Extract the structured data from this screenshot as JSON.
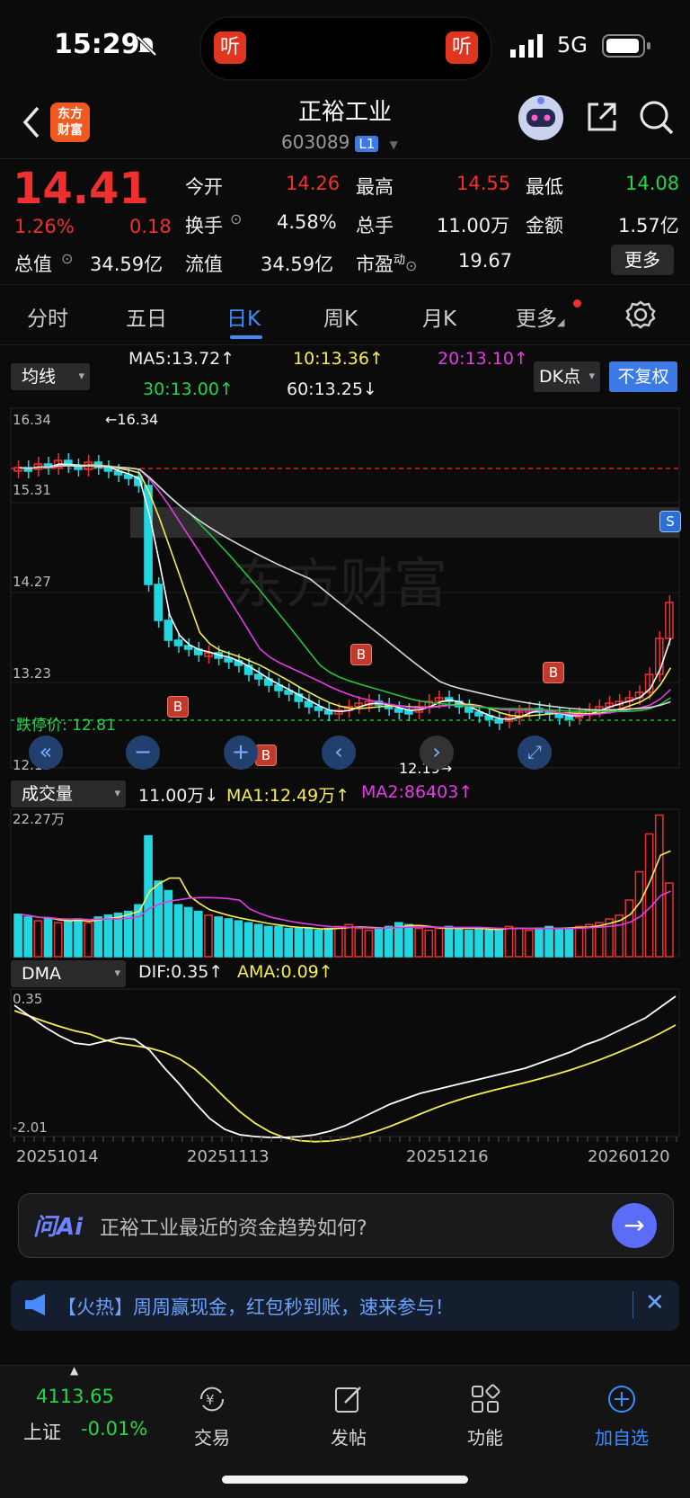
{
  "status": {
    "time": "15:29",
    "network": "5G",
    "island_left": "听",
    "island_right": "听"
  },
  "header": {
    "logo": "东方\n财富",
    "stock_name": "正裕工业",
    "stock_code": "603089",
    "level": "L1"
  },
  "quote": {
    "price": "14.41",
    "pct": "1.26%",
    "change": "0.18",
    "open_label": "今开",
    "open": "14.26",
    "high_label": "最高",
    "high": "14.55",
    "low_label": "最低",
    "low": "14.08",
    "turnover_label": "换手",
    "turnover": "4.58%",
    "volume_label": "总手",
    "volume": "11.00万",
    "amount_label": "金额",
    "amount": "1.57亿",
    "mktcap_label": "总值",
    "mktcap": "34.59亿",
    "float_label": "流值",
    "float": "34.59亿",
    "pe_label": "市盈",
    "pe_sup": "动",
    "pe": "19.67",
    "more": "更多"
  },
  "tabs": [
    "分时",
    "五日",
    "日K",
    "周K",
    "月K",
    "更多"
  ],
  "kline": {
    "indicator_select": "均线",
    "ma5": "MA5:13.72↑",
    "ma10": "10:13.36↑",
    "ma20": "20:13.10↑",
    "ma30": "30:13.00↑",
    "ma60": "60:13.25↓",
    "dk_button": "DK点",
    "fq_button": "不复权",
    "y_top": "16.34",
    "y_mid1": "15.31",
    "y_mid2": "14.27",
    "y_mid3": "13.23",
    "y_bottom": "12.19",
    "max_mark": "←16.34",
    "min_mark": "12.19→",
    "limit_down": "跌停价: 12.81",
    "b_marker": "B",
    "s_marker": "S"
  },
  "volume_panel": {
    "select": "成交量",
    "vol": "11.00万↓",
    "ma1": "MA1:12.49万↑",
    "ma2": "MA2:86403↑",
    "y_top": "22.27万"
  },
  "dma_panel": {
    "select": "DMA",
    "dif": "DIF:0.35↑",
    "ama": "AMA:0.09↑",
    "y_top": "0.35",
    "y_bottom": "-2.01"
  },
  "dates": [
    "20251014",
    "20251113",
    "20251216",
    "20260120"
  ],
  "ai": {
    "logo": "问Ai",
    "placeholder": "正裕工业最近的资金趋势如何?"
  },
  "banner": {
    "text": "【火热】周周赢现金，红包秒到账，速来参与！"
  },
  "nav": {
    "index_value": "4113.65",
    "index_name": "上证",
    "index_change": "-0.01%",
    "items": [
      "交易",
      "发帖",
      "功能",
      "加自选"
    ]
  },
  "colors": {
    "up": "#f0302e",
    "down": "#22d6e0",
    "accent": "#3c8cff"
  }
}
